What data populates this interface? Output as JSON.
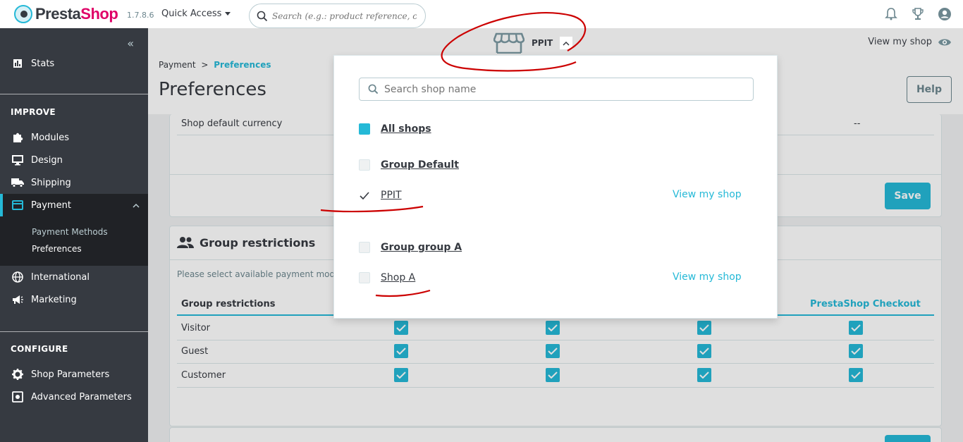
{
  "header": {
    "brand_prefix": "Presta",
    "brand_suffix": "Shop",
    "version": "1.7.8.6",
    "quick_access": "Quick Access",
    "search_placeholder": "Search (e.g.: product reference, custon"
  },
  "subheader": {
    "shop_name": "PPIT",
    "view_my_shop": "View my shop"
  },
  "sidebar": {
    "stats": "Stats",
    "improve": "IMPROVE",
    "modules": "Modules",
    "design": "Design",
    "shipping": "Shipping",
    "payment": "Payment",
    "payment_methods": "Payment Methods",
    "preferences": "Preferences",
    "international": "International",
    "marketing": "Marketing",
    "configure": "CONFIGURE",
    "shop_parameters": "Shop Parameters",
    "advanced_parameters": "Advanced Parameters"
  },
  "main": {
    "breadcrumb_parent": "Payment",
    "breadcrumb_sep": ">",
    "breadcrumb_current": "Preferences",
    "title": "Preferences",
    "help": "Help",
    "currency_label": "Shop default currency",
    "currency_value": "--",
    "save": "Save",
    "group_title": "Group restrictions",
    "group_desc": "Please select available payment module",
    "col_group": "Group restrictions",
    "col_checkout": "PrestaShop Checkout",
    "rows": [
      "Visitor",
      "Guest",
      "Customer"
    ]
  },
  "dropdown": {
    "search_placeholder": "Search shop name",
    "all_shops": "All shops",
    "group_default": "Group Default",
    "ppit": "PPIT",
    "view_shop_1": "View my shop",
    "group_a": "Group group A",
    "shop_a": "Shop A",
    "view_shop_2": "View my shop"
  },
  "colors": {
    "accent": "#25b9d7",
    "sidebar": "#363a41",
    "annotation": "#cc0000"
  }
}
